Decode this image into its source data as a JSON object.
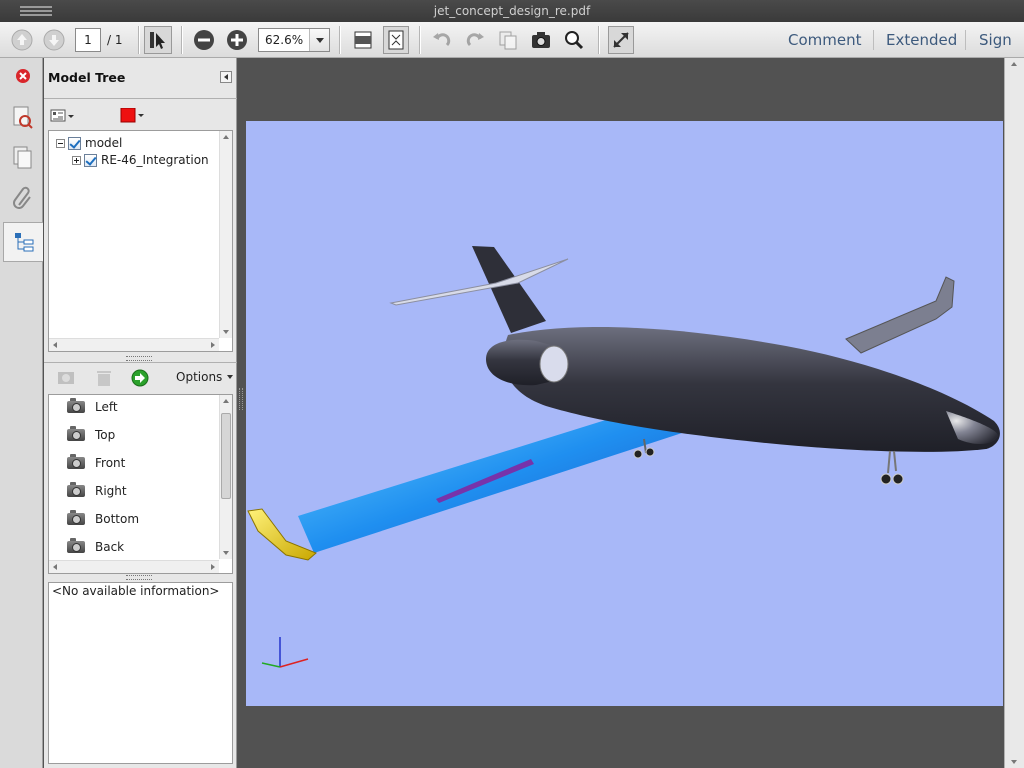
{
  "window": {
    "title": "jet_concept_design_re.pdf"
  },
  "toolbar": {
    "page_current": "1",
    "page_total": "/ 1",
    "zoom": "62.6%",
    "links": {
      "comment": "Comment",
      "extended": "Extended",
      "sign": "Sign"
    }
  },
  "panel": {
    "title": "Model Tree",
    "tree": [
      {
        "label": "model"
      },
      {
        "label": "RE-46_Integration"
      }
    ],
    "options_label": "Options",
    "views": [
      "Left",
      "Top",
      "Front",
      "Right",
      "Bottom",
      "Back"
    ],
    "info_text": "<No available information>"
  },
  "colors": {
    "viewport_background": "#a8b8f8",
    "fuselage": "#3a3b45",
    "wing": "#2b8ae6",
    "wingtip": "#e6d21a",
    "accent_link": "#3d5a7d"
  }
}
